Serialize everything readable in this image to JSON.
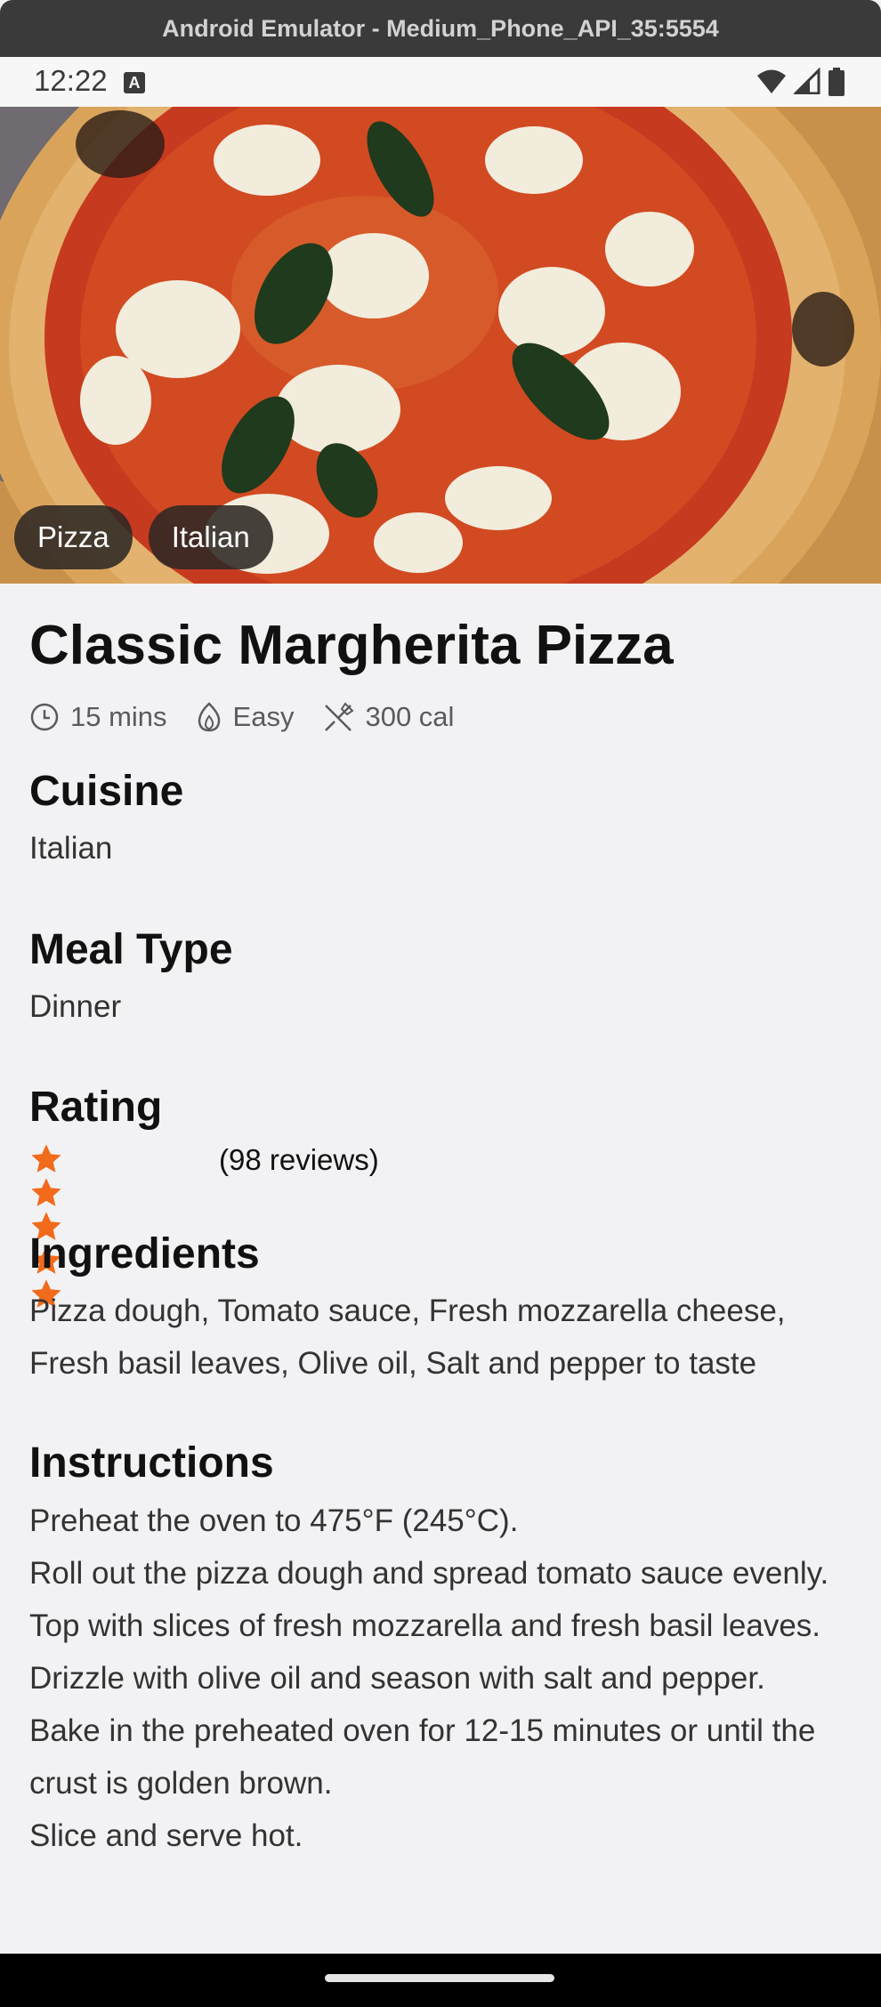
{
  "window": {
    "title": "Android Emulator - Medium_Phone_API_35:5554"
  },
  "status_bar": {
    "time": "12:22",
    "notification_glyph": "A",
    "icons": [
      "wifi-icon",
      "signal-icon",
      "battery-icon"
    ]
  },
  "recipe": {
    "tags": [
      "Pizza",
      "Italian"
    ],
    "title": "Classic Margherita Pizza",
    "meta": {
      "time": "15 mins",
      "difficulty": "Easy",
      "calories": "300 cal"
    },
    "cuisine": {
      "heading": "Cuisine",
      "value": "Italian"
    },
    "meal_type": {
      "heading": "Meal Type",
      "value": "Dinner"
    },
    "rating": {
      "heading": "Rating",
      "stars": 5,
      "reviews": "(98 reviews)",
      "star_color": "#f26a1b"
    },
    "ingredients": {
      "heading": "Ingredients",
      "text": "Pizza dough, Tomato sauce, Fresh mozzarella cheese, Fresh basil leaves, Olive oil, Salt and pepper to taste"
    },
    "instructions": {
      "heading": "Instructions",
      "steps": [
        "Preheat the oven to 475°F (245°C).",
        "Roll out the pizza dough and spread tomato sauce evenly.",
        "Top with slices of fresh mozzarella and fresh basil leaves.",
        "Drizzle with olive oil and season with salt and pepper.",
        "Bake in the preheated oven for 12-15 minutes or until the crust is golden brown.",
        "Slice and serve hot."
      ]
    }
  },
  "colors": {
    "background": "#f2f2f4",
    "chip_bg": "#2d2824",
    "accent_star": "#f26a1b"
  }
}
